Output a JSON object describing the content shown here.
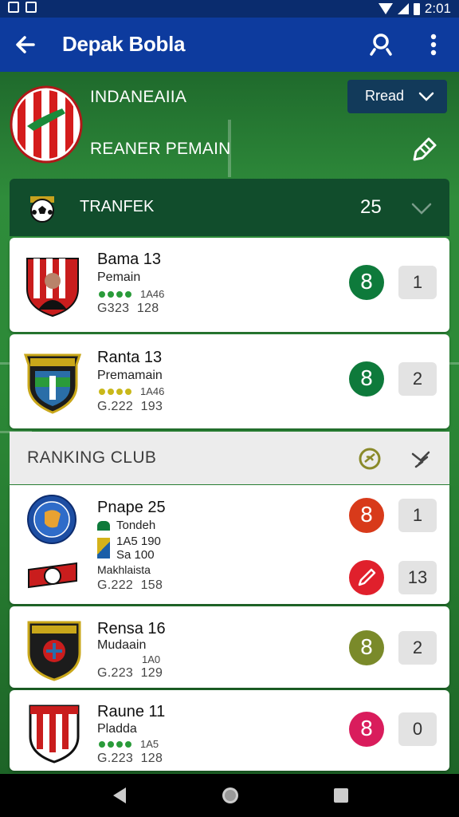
{
  "status_bar": {
    "time": "2:01"
  },
  "app_bar": {
    "title": "Depak Bobla",
    "back_icon": "arrow-left-icon",
    "search_icon": "search-icon",
    "more_icon": "more-vert-icon"
  },
  "team": {
    "name": "INDANEAIIA",
    "subtitle": "REANER PEMAIN",
    "dropdown_label": "Rread",
    "logo_colors": [
      "#d41c1c",
      "#ffffff",
      "#1a8a3a"
    ]
  },
  "transfer": {
    "label": "TRANFEK",
    "count": "25"
  },
  "players": [
    {
      "name": "Bama 13",
      "role": "Pemain",
      "stats": "1A46",
      "meta_a": "G323",
      "meta_b": "128",
      "badge": "8",
      "badge_color": "#0e7a3b",
      "rank": "1",
      "dot_color": "#2a9b3a"
    },
    {
      "name": "Ranta 13",
      "role": "Premamain",
      "stats": "1A46",
      "meta_a": "G.222",
      "meta_b": "193",
      "badge": "8",
      "badge_color": "#0e7a3b",
      "rank": "2",
      "dot_color": "#c9b81a"
    }
  ],
  "ranking": {
    "label": "RANKING CLUB",
    "clubs": [
      {
        "name": "Pnape 25",
        "lines": [
          "Tondeh",
          "1A5 190",
          "Sa 100"
        ],
        "extra": "Makhlaista",
        "meta_a": "G.222",
        "meta_b": "158",
        "badges": [
          {
            "value": "8",
            "color": "#d83a1a"
          },
          {
            "value": "pencil-icon",
            "color": "#e0202c"
          }
        ],
        "ranks": [
          "1",
          "13"
        ]
      },
      {
        "name": "Rensa 16",
        "role": "Mudaain",
        "stats": "1A0",
        "meta_a": "G.223",
        "meta_b": "129",
        "badge": "8",
        "badge_color": "#7a8a2a",
        "rank": "2"
      },
      {
        "name": "Raune 11",
        "role": "Pladda",
        "stats": "1A5",
        "meta_a": "G.223",
        "meta_b": "128",
        "badge": "8",
        "badge_color": "#d91c5c",
        "rank": "0",
        "dot_color": "#2a9b3a"
      }
    ]
  },
  "nav": {
    "back": "nav-back-icon",
    "home": "nav-home-icon",
    "recents": "nav-recents-icon"
  }
}
